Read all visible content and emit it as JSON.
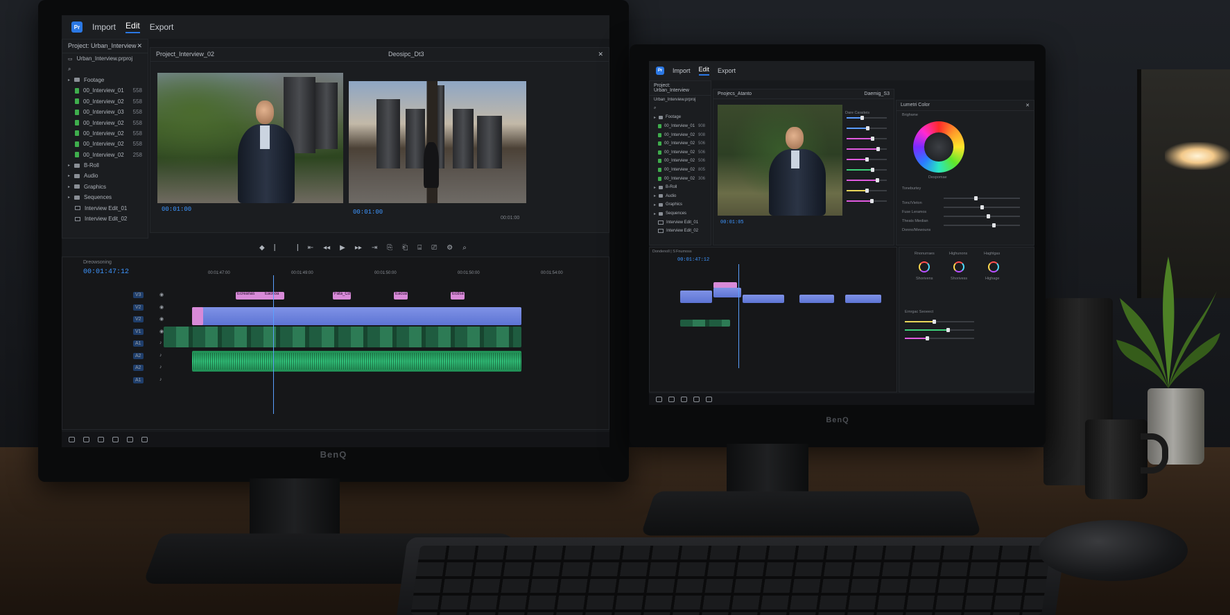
{
  "monitor_brand": "BenQ",
  "left": {
    "menu": [
      "Import",
      "Edit",
      "Export"
    ],
    "active_menu": "Edit",
    "project": {
      "title": "Project: Urban_Interview",
      "file": "Urban_Interview.prproj",
      "items": [
        {
          "type": "folder",
          "name": "Footage"
        },
        {
          "type": "file",
          "name": "00_Interview_01",
          "val": "558"
        },
        {
          "type": "file",
          "name": "00_Interview_02",
          "val": "558"
        },
        {
          "type": "file",
          "name": "00_Interview_03",
          "val": "558"
        },
        {
          "type": "file",
          "name": "00_Interview_02",
          "val": "558"
        },
        {
          "type": "file",
          "name": "00_Interview_02",
          "val": "558"
        },
        {
          "type": "file",
          "name": "00_Interview_02",
          "val": "558"
        },
        {
          "type": "file",
          "name": "00_Interview_02",
          "val": "258"
        },
        {
          "type": "folder",
          "name": "B-Roll"
        },
        {
          "type": "folder",
          "name": "Audio"
        },
        {
          "type": "folder",
          "name": "Graphics"
        },
        {
          "type": "folder",
          "name": "Sequences"
        },
        {
          "type": "seq",
          "name": "Interview Edit_01"
        },
        {
          "type": "seq",
          "name": "Interview Edit_02"
        }
      ]
    },
    "viewer": {
      "title": "Project_Interview_02",
      "source_label": "Deosipc_Dt3",
      "tc_left": "00:01:00",
      "tc_right": "00:01:00",
      "tc_right_end": "00:01:00"
    },
    "timeline": {
      "title": "Dreowsoning",
      "timecode": "00:01:47:12",
      "ruler": [
        "00:01:47:00",
        "00:01:49:00",
        "00:01:50:00",
        "00:01:50:00",
        "00:01:54:00"
      ],
      "tracks": [
        "V3",
        "V2",
        "V2",
        "V1",
        "A1",
        "A2",
        "A2",
        "A1"
      ],
      "title_clips": [
        "Ecreanas",
        "Eaosoa",
        "Fata_Cd",
        "Eacua",
        "Ecdsa"
      ]
    }
  },
  "right": {
    "menu": [
      "Import",
      "Edit",
      "Export"
    ],
    "active_menu": "Edit",
    "project": {
      "title": "Project: Urban_Interview",
      "file": "Urban_Interview.prproj",
      "items": [
        {
          "type": "folder",
          "name": "Footage"
        },
        {
          "type": "file",
          "name": "00_Interview_01",
          "val": "908"
        },
        {
          "type": "file",
          "name": "00_Interview_02",
          "val": "908"
        },
        {
          "type": "file",
          "name": "00_Interview_02",
          "val": "506"
        },
        {
          "type": "file",
          "name": "00_Interview_02",
          "val": "506"
        },
        {
          "type": "file",
          "name": "00_Interview_02",
          "val": "506"
        },
        {
          "type": "file",
          "name": "00_Interview_02",
          "val": "805"
        },
        {
          "type": "file",
          "name": "00_Interview_02",
          "val": "306"
        },
        {
          "type": "folder",
          "name": "B-Roll"
        },
        {
          "type": "folder",
          "name": "Audio"
        },
        {
          "type": "folder",
          "name": "Graphics"
        },
        {
          "type": "folder",
          "name": "Sequences"
        },
        {
          "type": "seq",
          "name": "Interview Edit_01"
        },
        {
          "type": "seq",
          "name": "Interview Edit_02"
        }
      ]
    },
    "viewer": {
      "title": "Pnojecs_Atanto",
      "source_label": "Daemig_S3",
      "tc": "00:01:05"
    },
    "effects": {
      "title": "Dare Caraiteis"
    },
    "lumetri": {
      "title": "Lumetri Color",
      "subtitle": "Brighwne",
      "wheel_label": "Despomae",
      "section2": "Toneburtey",
      "rows": [
        "Tonc/Vieton",
        "Fuse Leramos",
        "Theats Miedian",
        "Donno/Mewouns"
      ],
      "wheels": [
        "Rnonurraes",
        "Highunons",
        "Haghlgas"
      ],
      "wheel_sub": [
        "Shorivens",
        "Shorivess",
        "Highage"
      ],
      "section3": "Ernrgac Seoeect"
    },
    "timeline": {
      "title": "Dondenoll | S",
      "tab2": "Fnumoss",
      "timecode": "00:01:47:12"
    }
  }
}
